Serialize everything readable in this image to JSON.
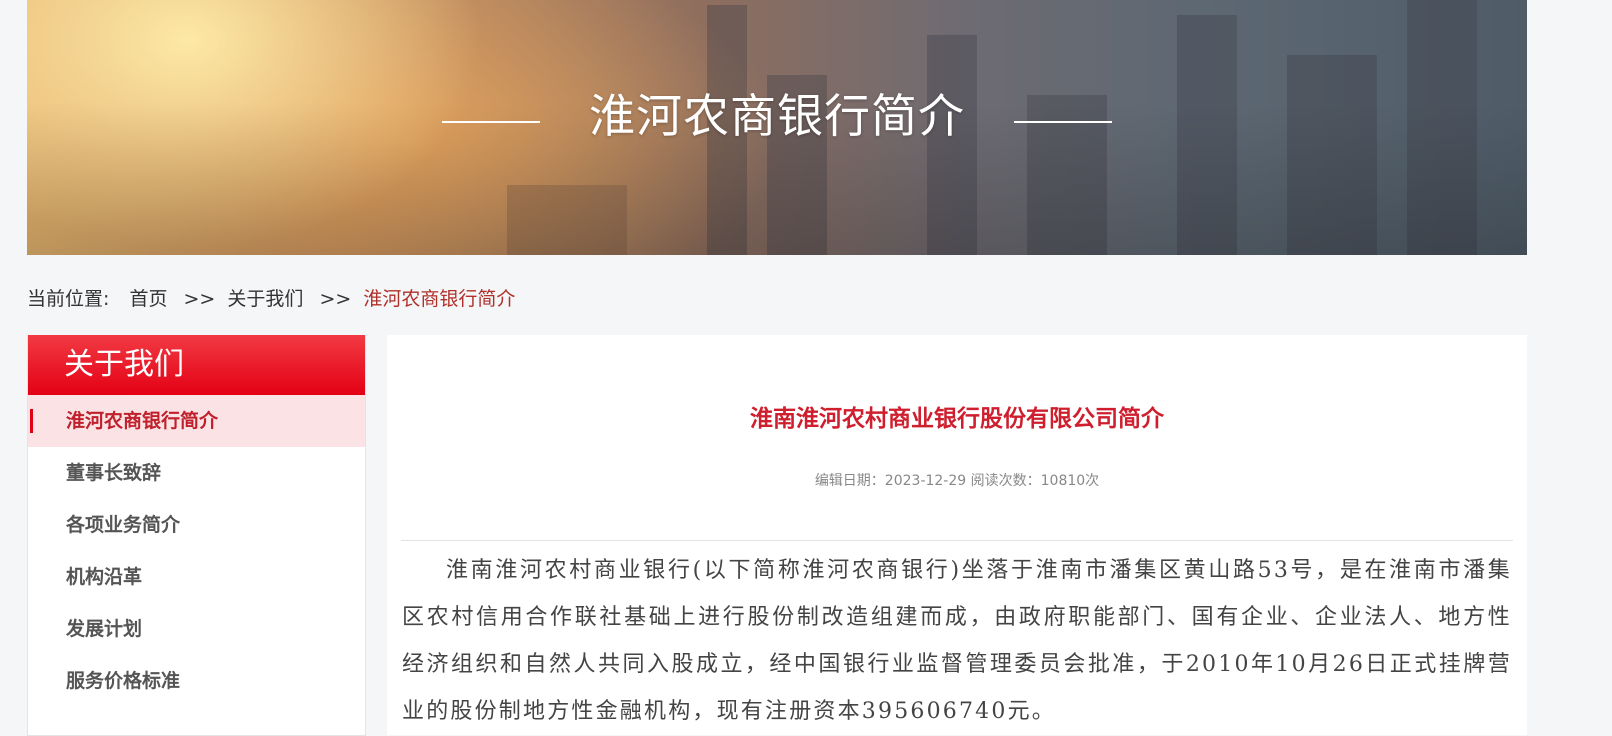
{
  "banner": {
    "title": "淮河农商银行简介"
  },
  "breadcrumb": {
    "prefix": "当前位置:",
    "items": [
      "首页",
      "关于我们",
      "淮河农商银行简介"
    ],
    "separator": ">>"
  },
  "sidebar": {
    "title": "关于我们",
    "items": [
      {
        "label": "淮河农商银行简介"
      },
      {
        "label": "董事长致辞"
      },
      {
        "label": "各项业务简介"
      },
      {
        "label": "机构沿革"
      },
      {
        "label": "发展计划"
      },
      {
        "label": "服务价格标准"
      }
    ]
  },
  "article": {
    "title": "淮南淮河农村商业银行股份有限公司简介",
    "meta": "编辑日期：2023-12-29 阅读次数：10810次",
    "body": "淮南淮河农村商业银行(以下简称淮河农商银行)坐落于淮南市潘集区黄山路53号，是在淮南市潘集区农村信用合作联社基础上进行股份制改造组建而成，由政府职能部门、国有企业、企业法人、地方性经济组织和自然人共同入股成立，经中国银行业监督管理委员会批准，于2010年10月26日正式挂牌营业的股份制地方性金融机构，现有注册资本395606740元。"
  }
}
